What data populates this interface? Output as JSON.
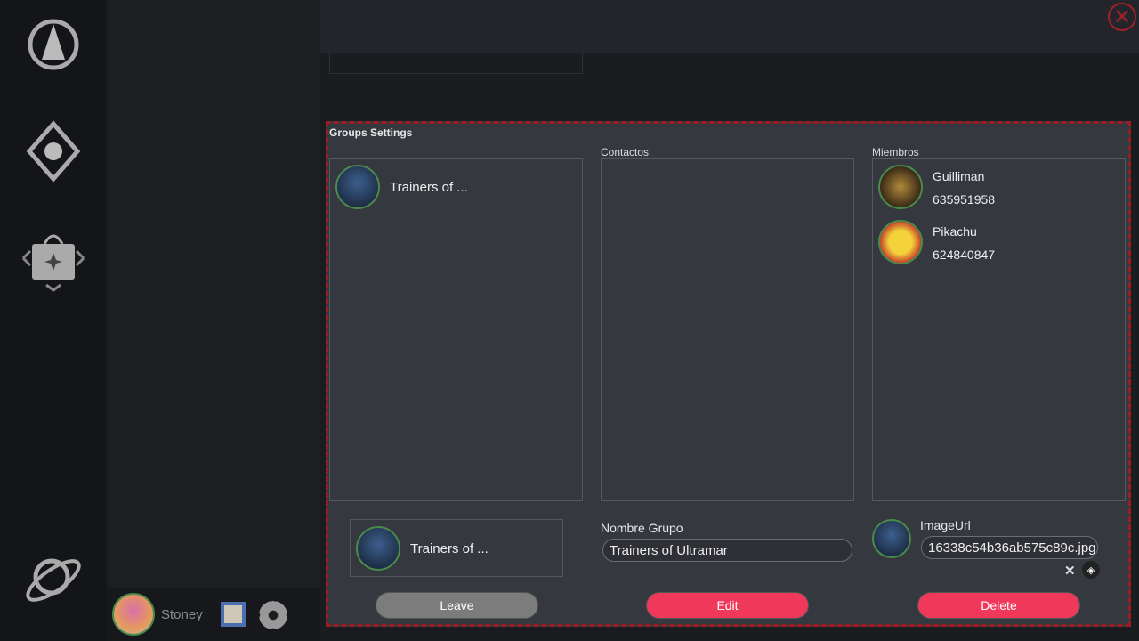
{
  "user": {
    "name": "Stoney"
  },
  "dialog": {
    "title": "Groups Settings",
    "contacts_label": "Contactos",
    "members_label": "Miembros",
    "groups": [
      {
        "name": "Trainers of ..."
      }
    ],
    "members": [
      {
        "name": "Guilliman",
        "phone": "635951958"
      },
      {
        "name": "Pikachu",
        "phone": "624840847"
      }
    ],
    "selected_group": {
      "name": "Trainers of ..."
    },
    "group_name_label": "Nombre Grupo",
    "group_name_value": "Trainers of Ultramar",
    "image_url_label": "ImageUrl",
    "image_url_value": "16338c54b36ab575c89c.jpg",
    "buttons": {
      "leave": "Leave",
      "edit": "Edit",
      "delete": "Delete"
    }
  },
  "colors": {
    "accent": "#f0395a",
    "border": "#9b1c22"
  }
}
